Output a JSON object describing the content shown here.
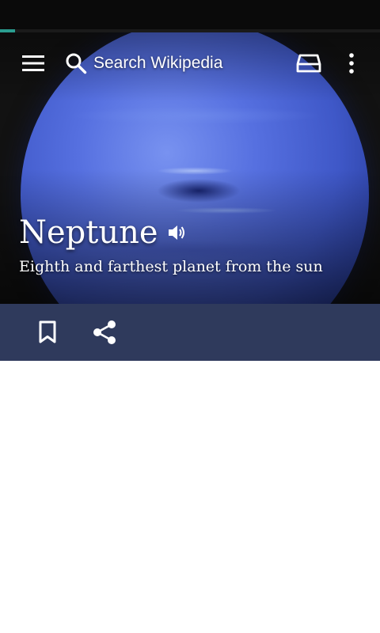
{
  "app": {
    "search_label": "Search Wikipedia"
  },
  "progress": {
    "fraction": 0.04,
    "color": "#2a9d8f"
  },
  "article": {
    "title": "Neptune",
    "description": "Eighth and farthest planet from the sun"
  },
  "toolbar": {
    "menu_icon": "hamburger-menu-icon",
    "search_icon": "search-icon",
    "reading_icon": "reading-list-icon",
    "overflow_icon": "more-vert-icon"
  },
  "actions": {
    "bookmark_icon": "bookmark-outline-icon",
    "share_icon": "share-icon",
    "bar_color": "#2f3a5c"
  }
}
